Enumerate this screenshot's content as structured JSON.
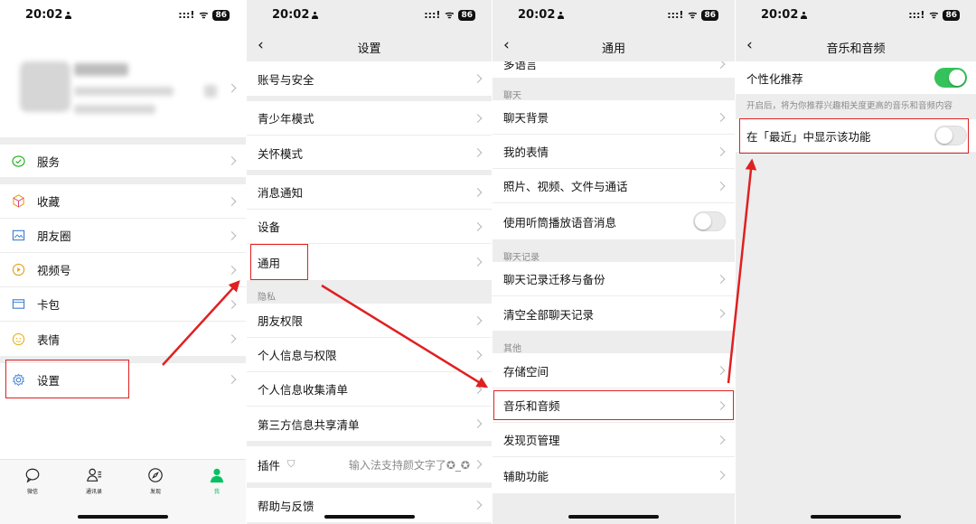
{
  "status": {
    "time": "20:02",
    "signal": ":::!",
    "wifi": "ᯤ",
    "battery": "86"
  },
  "panel1": {
    "menu": [
      {
        "label": "服务",
        "icon": "service-icon"
      },
      {
        "label": "收藏",
        "icon": "favorites-icon"
      },
      {
        "label": "朋友圈",
        "icon": "moments-icon"
      },
      {
        "label": "视频号",
        "icon": "channels-icon"
      },
      {
        "label": "卡包",
        "icon": "card-icon"
      },
      {
        "label": "表情",
        "icon": "sticker-icon"
      },
      {
        "label": "设置",
        "icon": "settings-icon"
      }
    ],
    "tabs": [
      {
        "label": "微信",
        "icon": "chat-icon"
      },
      {
        "label": "通讯录",
        "icon": "contacts-icon"
      },
      {
        "label": "发现",
        "icon": "discover-icon"
      },
      {
        "label": "我",
        "icon": "me-icon"
      }
    ],
    "active_tab": "我"
  },
  "panel2": {
    "title": "设置",
    "rows": [
      "账号与安全",
      "青少年模式",
      "关怀模式",
      "消息通知",
      "设备",
      "通用",
      "朋友权限",
      "个人信息与权限",
      "个人信息收集清单",
      "第三方信息共享清单",
      "插件",
      "帮助与反馈"
    ],
    "section_privacy": "隐私",
    "plugin_hint": "输入法支持颜文字了✪_✪"
  },
  "panel3": {
    "title": "通用",
    "partial_row": "多语言",
    "section_chat": "聊天",
    "chat_rows": [
      "聊天背景",
      "我的表情",
      "照片、视频、文件与通话",
      "使用听筒播放语音消息"
    ],
    "section_history": "聊天记录",
    "history_rows": [
      "聊天记录迁移与备份",
      "清空全部聊天记录"
    ],
    "section_other": "其他",
    "other_rows": [
      "存储空间",
      "音乐和音频",
      "发现页管理",
      "辅助功能"
    ],
    "earpiece_toggle": false
  },
  "panel4": {
    "title": "音乐和音频",
    "personalized_label": "个性化推荐",
    "personalized_on": true,
    "personalized_desc": "开启后，将为你推荐兴趣相关度更高的音乐和音频内容",
    "recent_label": "在「最近」中显示该功能",
    "recent_on": false
  },
  "colors": {
    "highlight": "#e02020",
    "toggle_on": "#35c25a",
    "accent_green": "#07c160"
  }
}
